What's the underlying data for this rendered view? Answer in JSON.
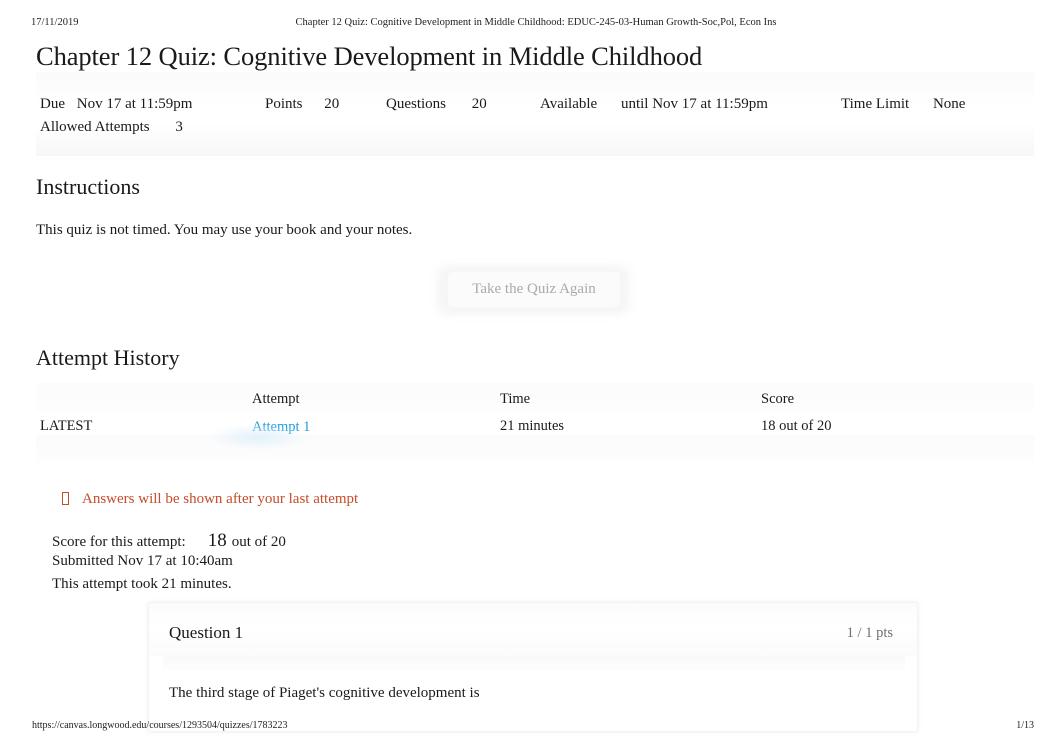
{
  "print_header": {
    "date": "17/11/2019",
    "document_title": "Chapter 12 Quiz: Cognitive Development in Middle Childhood: EDUC-245-03-Human Growth-Soc,Pol, Econ Ins"
  },
  "quiz": {
    "title": "Chapter 12 Quiz: Cognitive Development in Middle Childhood",
    "meta": {
      "due_label": "Due",
      "due_value": "Nov 17 at 11:59pm",
      "points_label": "Points",
      "points_value": "20",
      "questions_label": "Questions",
      "questions_value": "20",
      "available_label": "Available",
      "available_value": "until Nov 17 at 11:59pm",
      "time_limit_label": "Time Limit",
      "time_limit_value": "None",
      "allowed_attempts_label": "Allowed Attempts",
      "allowed_attempts_value": "3"
    }
  },
  "instructions": {
    "heading": "Instructions",
    "text": "This quiz is not timed. You may use your book and your notes."
  },
  "actions": {
    "retake_label": "Take the Quiz Again"
  },
  "attempt_history": {
    "heading": "Attempt History",
    "columns": [
      "",
      "Attempt",
      "Time",
      "Score"
    ],
    "rows": [
      {
        "marker": "LATEST",
        "attempt": "Attempt 1",
        "time": "21 minutes",
        "score": "18 out of 20"
      }
    ]
  },
  "notice": {
    "icon": "warning-box-icon",
    "text": "Answers will be shown after your last attempt",
    "color": "#c54d2a"
  },
  "attempt_detail": {
    "score_label": "Score for this attempt:",
    "score_value": "18",
    "score_suffix": "out of 20",
    "submitted": "Submitted Nov 17 at 10:40am",
    "duration": "This attempt took 21 minutes."
  },
  "question": {
    "title": "Question 1",
    "points": "1 / 1 pts",
    "text": "The third stage of Piaget's cognitive development is"
  },
  "print_footer": {
    "url": "https://canvas.longwood.edu/courses/1293504/quizzes/1783223",
    "page": "1/13"
  },
  "colors": {
    "link": "#1f9bda",
    "notice": "#c54d2a",
    "text": "#1a1a1a",
    "muted": "#6e7074"
  }
}
